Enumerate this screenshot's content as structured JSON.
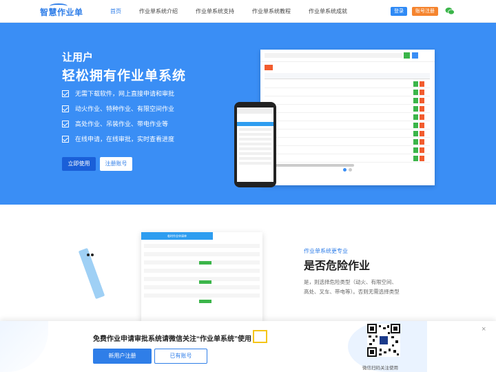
{
  "header": {
    "logo": "智慧作业单",
    "nav": [
      "首页",
      "作业单系统介绍",
      "作业单系统支持",
      "作业单系统教程",
      "作业单系统成就"
    ],
    "login_label": "登录",
    "trial_label": "账号注册",
    "wechat_icon": "wechat-icon"
  },
  "hero": {
    "subtitle": "让用户",
    "title": "轻松拥有作业单系统",
    "features": [
      "无需下载软件，网上直接申请和审批",
      "动火作业、特种作业、有限空间作业",
      "高处作业、吊装作业、带电作业等",
      "在线申请，在线审批，实时查看进度"
    ],
    "use_now_label": "立即使用",
    "register_label": "注册账号"
  },
  "section2": {
    "subtitle": "作业单系统更专业",
    "title": "是否危险作业",
    "description": "是，则选择危险类型（动火、有限空间、高处、叉车、带电等）。否则无需选择类型",
    "form_header": "临时作业申请单"
  },
  "banner": {
    "text": "免费作业申请审批系统请微信关注“作业单系统”使用",
    "new_user_label": "新用户注册",
    "has_account_label": "已有账号",
    "qr_caption": "微信扫码关注使用",
    "close": "×"
  }
}
